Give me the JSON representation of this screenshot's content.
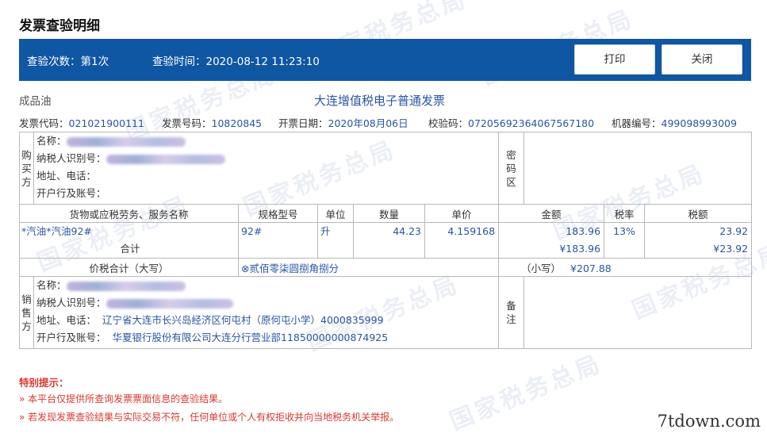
{
  "page": {
    "title": "发票查验明细"
  },
  "bar": {
    "check_count": "查验次数：第1次",
    "check_time": "查验时间：2020-08-12 11:23:10",
    "print_label": "打印",
    "close_label": "关闭"
  },
  "invoice": {
    "category": "成品油",
    "title": "大连增值税电子普通发票",
    "code_label": "发票代码：",
    "code": "021021900111",
    "number_label": "发票号码：",
    "number": "10820845",
    "date_label": "开票日期：",
    "date": "2020年08月06日",
    "check_code_label": "校验码：",
    "check_code": "07205692364067567180",
    "machine_label": "机器编号：",
    "machine": "499098993009"
  },
  "buyer": {
    "section_label": "购买方",
    "name_label": "名称：",
    "tax_id_label": "纳税人识别号：",
    "addr_label": "地址、电话：",
    "bank_label": "开户行及账号：",
    "pwd_label": "密码区"
  },
  "items": {
    "headers": {
      "name": "货物或应税劳务、服务名称",
      "spec": "规格型号",
      "unit": "单位",
      "qty": "数量",
      "price": "单价",
      "amount": "金额",
      "rate": "税率",
      "tax": "税额"
    },
    "rows": [
      {
        "name": "*汽油*汽油92#",
        "spec": "92#",
        "unit": "升",
        "qty": "44.23",
        "price": "4.159168",
        "amount": "183.96",
        "rate": "13%",
        "tax": "23.92"
      }
    ],
    "total_label": "合计",
    "total_amount": "¥183.96",
    "total_tax": "¥23.92"
  },
  "total": {
    "label": "价税合计（大写）",
    "upper": "⊗贰佰零柒圆捌角捌分",
    "lower_label": "（小写）",
    "lower": "¥207.88"
  },
  "seller": {
    "section_label": "销售方",
    "name_label": "名称：",
    "tax_id_label": "纳税人识别号：",
    "addr_label": "地址、电话：",
    "addr": "辽宁省大连市长兴岛经济区何屯村（原何屯小学）4000835999",
    "bank_label": "开户行及账号：",
    "bank": "华夏银行股份有限公司大连分行营业部11850000000874925",
    "remark_label": "备注"
  },
  "notice": {
    "title": "特别提示：",
    "lines": [
      "» 本平台仅提供所查询发票票面信息的查验结果。",
      "» 若发现发票查验结果与实际交易不符，任何单位或个人有权拒收并向当地税务机关举报。"
    ]
  },
  "watermark": "国家税务总局",
  "site": "7tdown.com"
}
